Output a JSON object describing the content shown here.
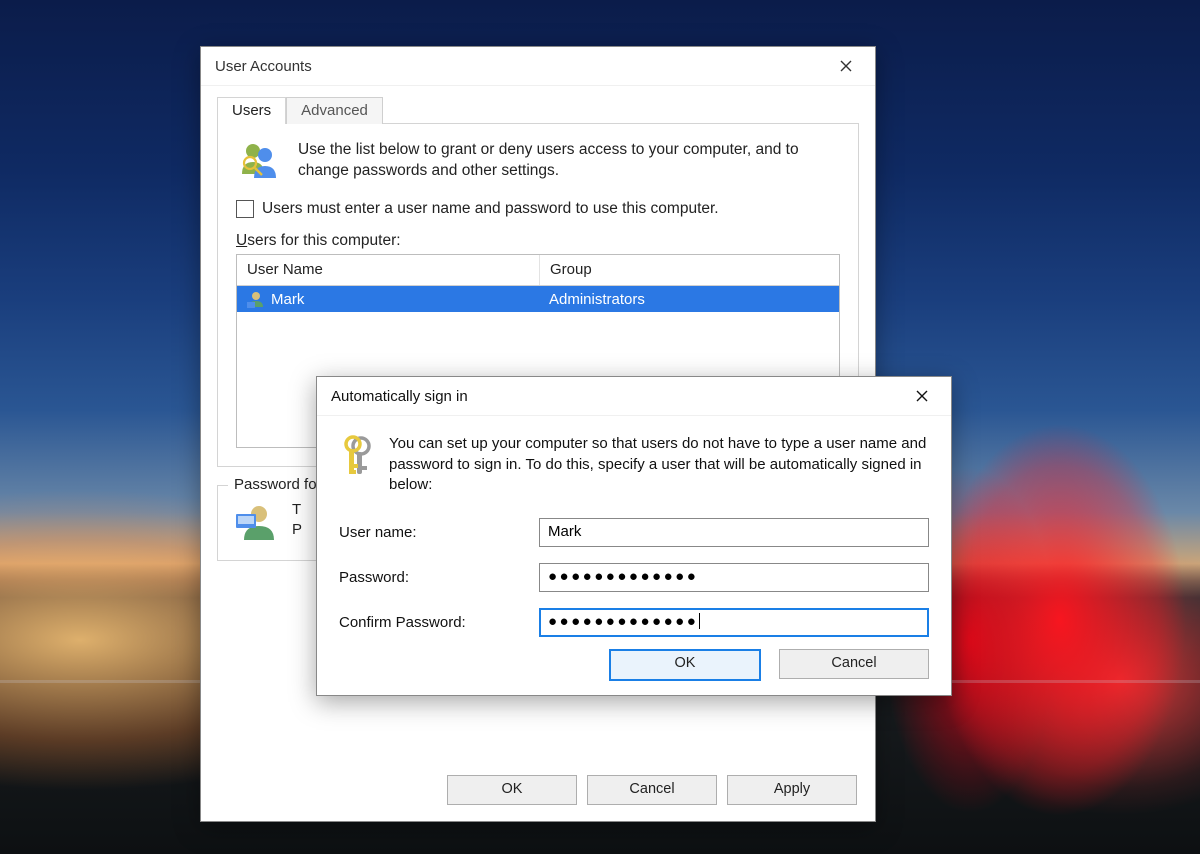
{
  "userAccounts": {
    "title": "User Accounts",
    "tabs": {
      "users": "Users",
      "advanced": "Advanced"
    },
    "intro": "Use the list below to grant or deny users access to your computer, and to change passwords and other settings.",
    "checkboxLabel": "Users must enter a user name and password to use this computer.",
    "usersForThis_prefix": "U",
    "usersForThis_rest": "sers for this computer:",
    "columns": {
      "userName": "User Name",
      "group": "Group"
    },
    "rows": [
      {
        "userName": "Mark",
        "group": "Administrators"
      }
    ],
    "passwordLegend": "Password fo",
    "pwLine1": "T",
    "pwLine2": "P",
    "buttons": {
      "ok": "OK",
      "cancel": "Cancel",
      "apply": "Apply"
    }
  },
  "autoSignIn": {
    "title": "Automatically sign in",
    "intro": "You can set up your computer so that users do not have to type a user name and password to sign in. To do this, specify a user that will be automatically signed in below:",
    "labels": {
      "userName": "User name:",
      "password": "Password:",
      "confirm": "Confirm Password:"
    },
    "values": {
      "userName": "Mark",
      "passwordMasked": "●●●●●●●●●●●●●",
      "confirmMasked": "●●●●●●●●●●●●●"
    },
    "buttons": {
      "ok": "OK",
      "cancel": "Cancel"
    }
  }
}
